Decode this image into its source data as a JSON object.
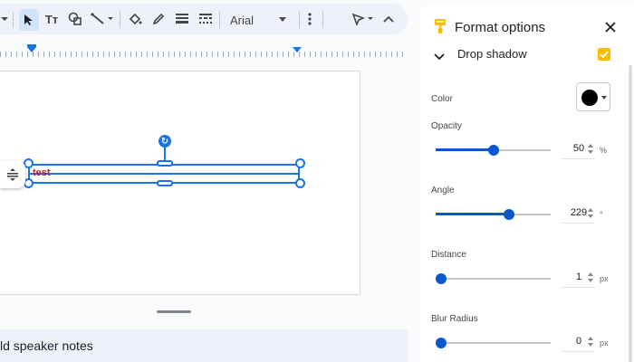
{
  "toolbar": {
    "font_name": "Arial",
    "icons": [
      "chevron-down-icon",
      "select-cursor-icon",
      "text-box-icon",
      "shapes-icon",
      "line-icon",
      "fill-color-icon",
      "border-color-icon",
      "border-weight-icon",
      "border-dash-icon",
      "font-select",
      "more-vert-icon",
      "pen-icon",
      "collapse-icon"
    ]
  },
  "canvas": {
    "textbox_text": "test",
    "textbox_text_color": "#c5221f",
    "selection_color": "#1a73e8"
  },
  "notes": {
    "label": "ld speaker notes"
  },
  "panel": {
    "title": "Format options",
    "section": {
      "title": "Drop shadow",
      "checked": true,
      "check_color": "#fbbc04"
    },
    "color": {
      "label": "Color",
      "value": "#000000"
    },
    "opacity": {
      "label": "Opacity",
      "value": "50",
      "unit": "%",
      "fraction": 0.5
    },
    "angle": {
      "label": "Angle",
      "value": "229",
      "unit": "°",
      "fraction": 0.64
    },
    "distance": {
      "label": "Distance",
      "value": "1",
      "unit": "px",
      "fraction": 0.0
    },
    "blur_radius": {
      "label": "Blur Radius",
      "value": "0",
      "unit": "px",
      "fraction": 0.0
    }
  },
  "colors": {
    "accent": "#0b57d0",
    "toolbar_bg": "#edf2fa",
    "active_tool_bg": "#d3e3fd"
  }
}
